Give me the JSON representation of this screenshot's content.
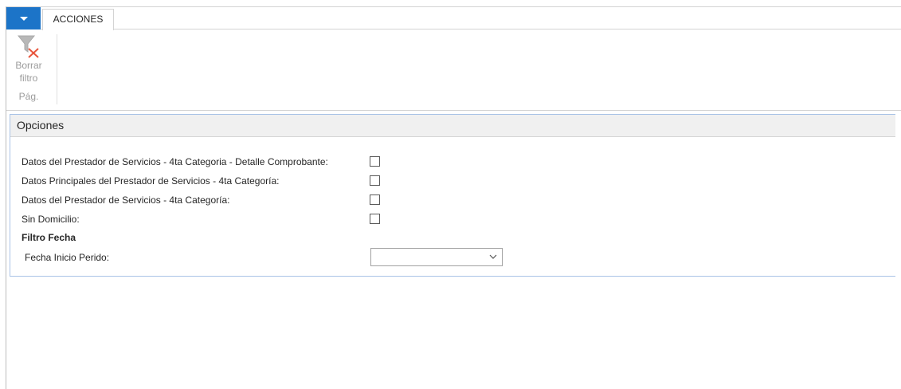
{
  "ribbon": {
    "tab_label": "ACCIONES",
    "clear_filter_label_line1": "Borrar",
    "clear_filter_label_line2": "filtro",
    "group_label": "Pág."
  },
  "options": {
    "header": "Opciones",
    "fields": [
      {
        "label": "Datos del Prestador de Servicios - 4ta Categoria - Detalle Comprobante:",
        "checked": false
      },
      {
        "label": "Datos Principales del Prestador de Servicios - 4ta Categoría:",
        "checked": false
      },
      {
        "label": "Datos del Prestador de Servicios - 4ta Categoría:",
        "checked": false
      },
      {
        "label": "Sin Domicilio:",
        "checked": false
      }
    ],
    "filter_section_title": "Filtro Fecha",
    "date_label": "Fecha Inicio  Perido:",
    "date_value": ""
  },
  "colors": {
    "accent": "#1c74c8",
    "panel_border": "#a9c3e6",
    "clear_filter_icon_x": "#e8553c"
  },
  "icons": [
    "chevron-down-icon",
    "clear-filter-icon",
    "checkbox",
    "dropdown-chevron-icon"
  ]
}
